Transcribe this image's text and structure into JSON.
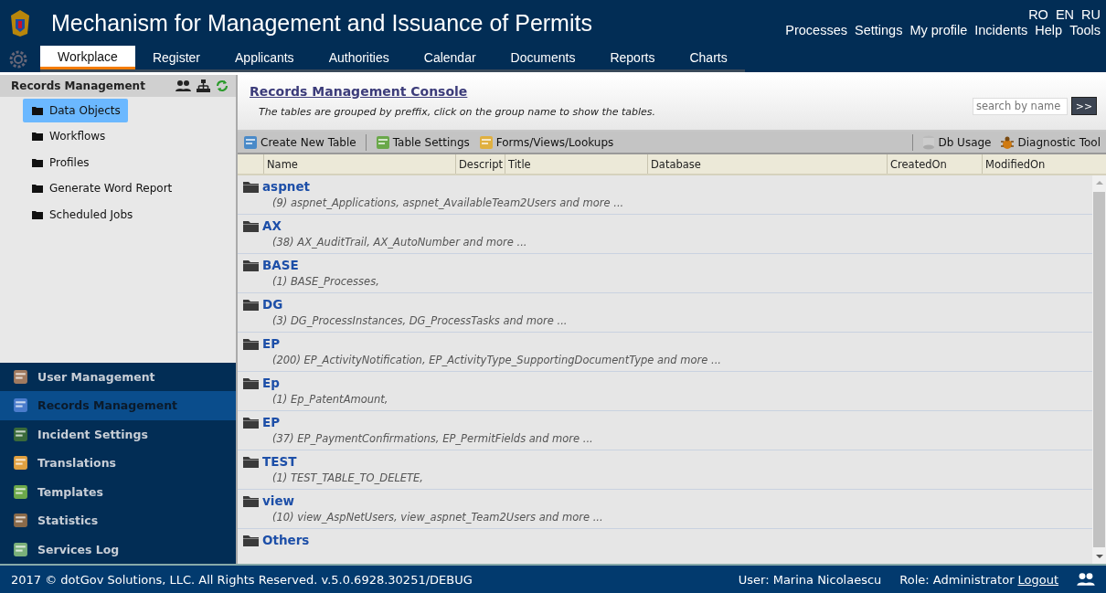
{
  "header": {
    "title": "Mechanism for Management and Issuance of Permits",
    "languages": [
      "RO",
      "EN",
      "RU"
    ],
    "links": [
      "Processes",
      "Settings",
      "My profile",
      "Incidents",
      "Help",
      "Tools"
    ]
  },
  "nav_tabs": [
    {
      "label": "Workplace",
      "selected": true
    },
    {
      "label": "Register",
      "selected": false
    },
    {
      "label": "Applicants",
      "selected": false
    },
    {
      "label": "Authorities",
      "selected": false
    },
    {
      "label": "Calendar",
      "selected": false
    },
    {
      "label": "Documents",
      "selected": false
    },
    {
      "label": "Reports",
      "selected": false
    },
    {
      "label": "Charts",
      "selected": false
    }
  ],
  "sidebar": {
    "title": "Records Management",
    "items": [
      {
        "label": "Data Objects",
        "selected": true
      },
      {
        "label": "Workflows",
        "selected": false
      },
      {
        "label": "Profiles",
        "selected": false
      },
      {
        "label": "Generate Word Report",
        "selected": false
      },
      {
        "label": "Scheduled Jobs",
        "selected": false
      }
    ],
    "sections": [
      {
        "label": "User Management",
        "selected": false
      },
      {
        "label": "Records Management",
        "selected": true
      },
      {
        "label": "Incident Settings",
        "selected": false
      },
      {
        "label": "Translations",
        "selected": false
      },
      {
        "label": "Templates",
        "selected": false
      },
      {
        "label": "Statistics",
        "selected": false
      },
      {
        "label": "Services Log",
        "selected": false
      }
    ]
  },
  "console": {
    "title": "Records Management Console",
    "description": "The tables are grouped by preffix, click on the group name to show the tables.",
    "search": {
      "placeholder": "search by name",
      "button": ">>"
    }
  },
  "toolbar": {
    "left": [
      "Create New Table",
      "Table Settings",
      "Forms/Views/Lookups"
    ],
    "right": [
      "Db Usage",
      "Diagnostic Tool"
    ]
  },
  "table": {
    "columns": [
      "Name",
      "Descript",
      "Title",
      "Database",
      "CreatedOn",
      "ModifiedOn"
    ],
    "groups": [
      {
        "name": "aspnet",
        "summary": "(9) aspnet_Applications, aspnet_AvailableTeam2Users and more ..."
      },
      {
        "name": "AX",
        "summary": "(38) AX_AuditTrail, AX_AutoNumber and more ..."
      },
      {
        "name": "BASE",
        "summary": "(1) BASE_Processes,"
      },
      {
        "name": "DG",
        "summary": "(3) DG_ProcessInstances, DG_ProcessTasks and more ..."
      },
      {
        "name": "EP",
        "summary": "(200) EP_ActivityNotification, EP_ActivityType_SupportingDocumentType and more ..."
      },
      {
        "name": "Ep",
        "summary": "(1) Ep_PatentAmount,"
      },
      {
        "name": "EP",
        "summary": "(37) EP_PaymentConfirmations, EP_PermitFields and more ..."
      },
      {
        "name": "TEST",
        "summary": "(1) TEST_TABLE_TO_DELETE,"
      },
      {
        "name": "view",
        "summary": "(10) view_AspNetUsers, view_aspnet_Team2Users and more ..."
      },
      {
        "name": "Others"
      }
    ]
  },
  "footer": {
    "copyright": "2017 © dotGov Solutions, LLC. All Rights Reserved. v.5.0.6928.30251/DEBUG",
    "user": "User: Marina Nicolaescu",
    "role": "Role: Administrator",
    "logout": "Logout"
  }
}
